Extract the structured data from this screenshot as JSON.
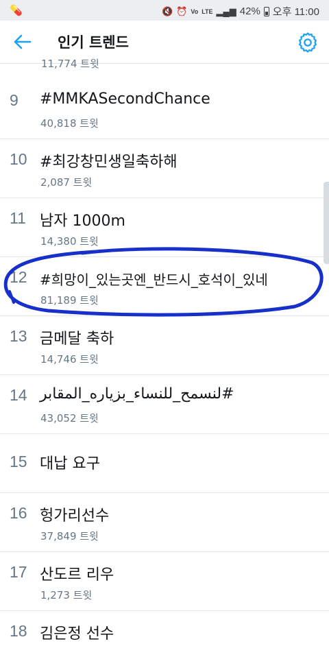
{
  "status_bar": {
    "left_icon": "pill-icon",
    "network": "LTE",
    "battery": "42%",
    "time": "오후 11:00"
  },
  "header": {
    "title": "인기 트렌드"
  },
  "partial_row": {
    "count": "11,774 트윗"
  },
  "trends": [
    {
      "rank": "9",
      "name": "#MMKASecondChance",
      "count": "40,818 트윗"
    },
    {
      "rank": "10",
      "name": "#최강창민생일축하해",
      "count": "2,087 트윗"
    },
    {
      "rank": "11",
      "name": "남자 1000m",
      "count": "14,380 트윗"
    },
    {
      "rank": "12",
      "name": "#희망이_있는곳엔_반드시_호석이_있네",
      "count": "81,189 트윗"
    },
    {
      "rank": "13",
      "name": "금메달 축하",
      "count": "14,746 트윗"
    },
    {
      "rank": "14",
      "name": "#لنسمح_للنساء_بزياره_المقابر",
      "count": "43,052 트윗"
    },
    {
      "rank": "15",
      "name": "대납 요구",
      "count": ""
    },
    {
      "rank": "16",
      "name": "헝가리선수",
      "count": "37,849 트윗"
    },
    {
      "rank": "17",
      "name": "산도르 리우",
      "count": "1,273 트윗"
    },
    {
      "rank": "18",
      "name": "김은정 선수",
      "count": ""
    }
  ],
  "colors": {
    "accent": "#1da1f2",
    "annotation": "#1730c9"
  }
}
